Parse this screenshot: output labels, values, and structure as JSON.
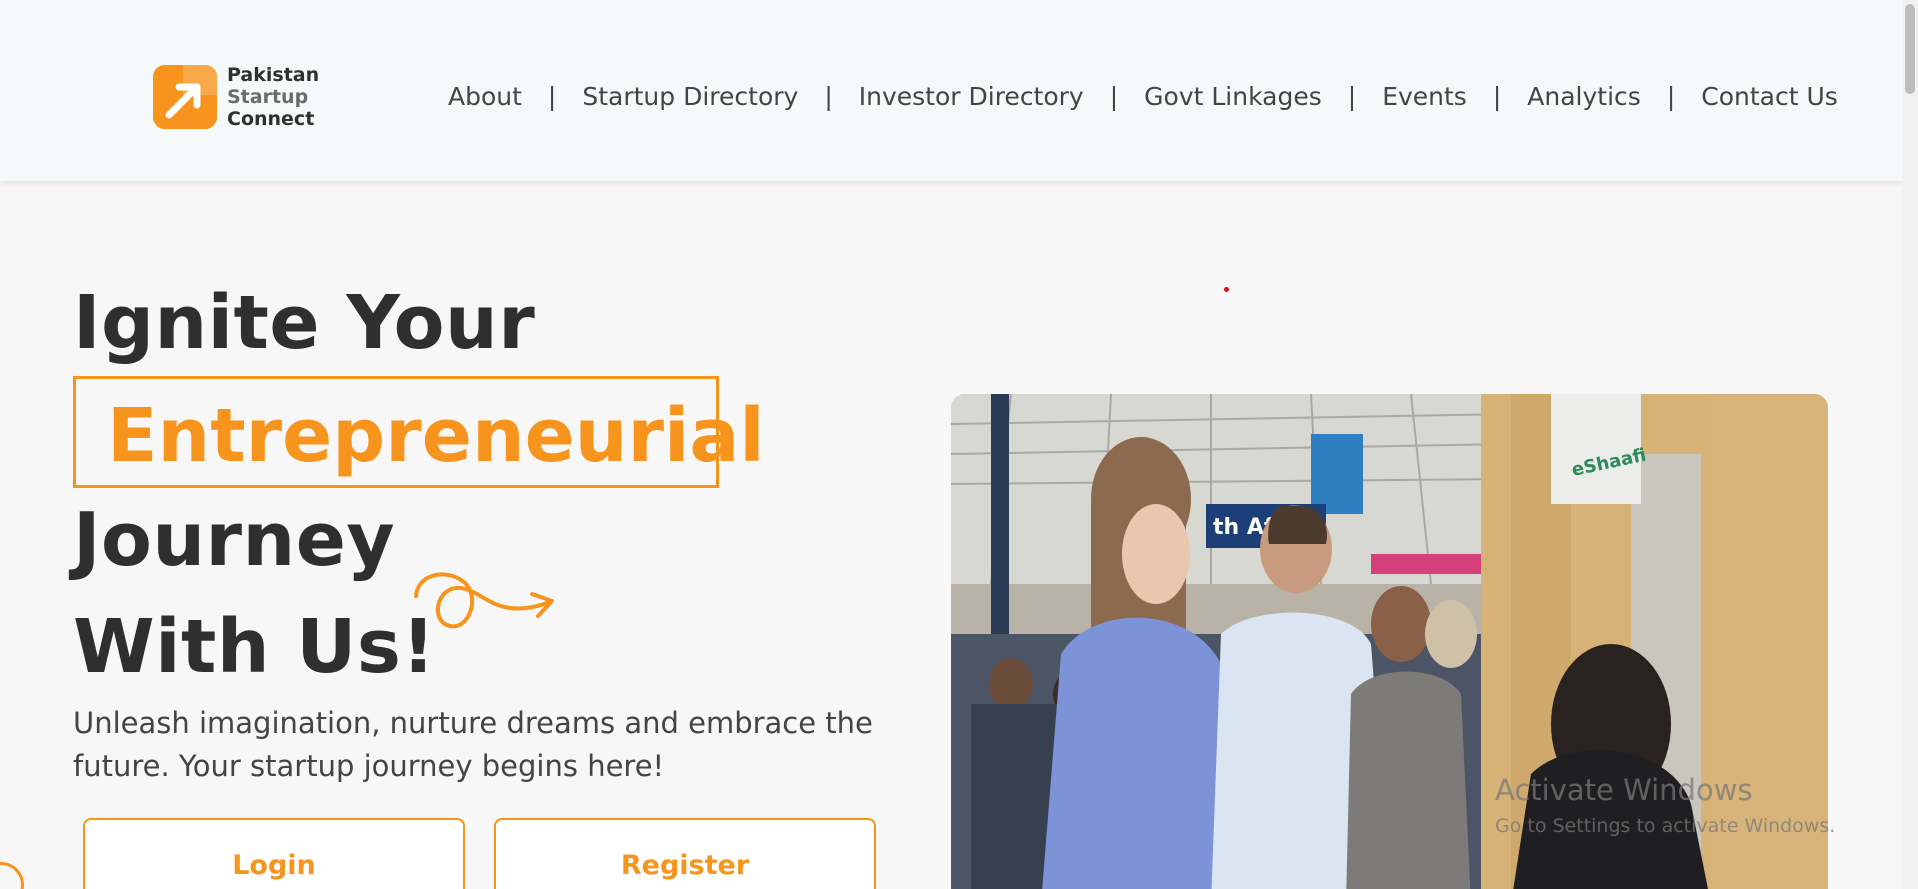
{
  "header": {
    "logo": {
      "line1": "Pakistan",
      "line2": "Startup",
      "line3": "Connect",
      "icon": "arrow-up-right-icon"
    },
    "nav": [
      {
        "label": "About"
      },
      {
        "label": "Startup Directory"
      },
      {
        "label": "Investor Directory"
      },
      {
        "label": "Govt Linkages"
      },
      {
        "label": "Events"
      },
      {
        "label": "Analytics"
      },
      {
        "label": "Contact Us"
      }
    ],
    "separator": "|"
  },
  "hero": {
    "line1": "Ignite Your",
    "highlight": "Entrepreneurial",
    "line3": "Journey",
    "line4": "With Us!",
    "subtitle": "Unleash imagination, nurture dreams and embrace the future. Your startup journey begins here!",
    "login_label": "Login",
    "register_label": "Register"
  },
  "photo": {
    "signs": [
      "eShaafi",
      "th Africa"
    ]
  },
  "watermark": {
    "title": "Activate Windows",
    "subtitle": "Go to Settings to activate Windows."
  },
  "colors": {
    "accent": "#f7941d",
    "heading": "#2f2f2f",
    "background": "#f7f7f7",
    "header_bg": "#f6f9f9"
  }
}
